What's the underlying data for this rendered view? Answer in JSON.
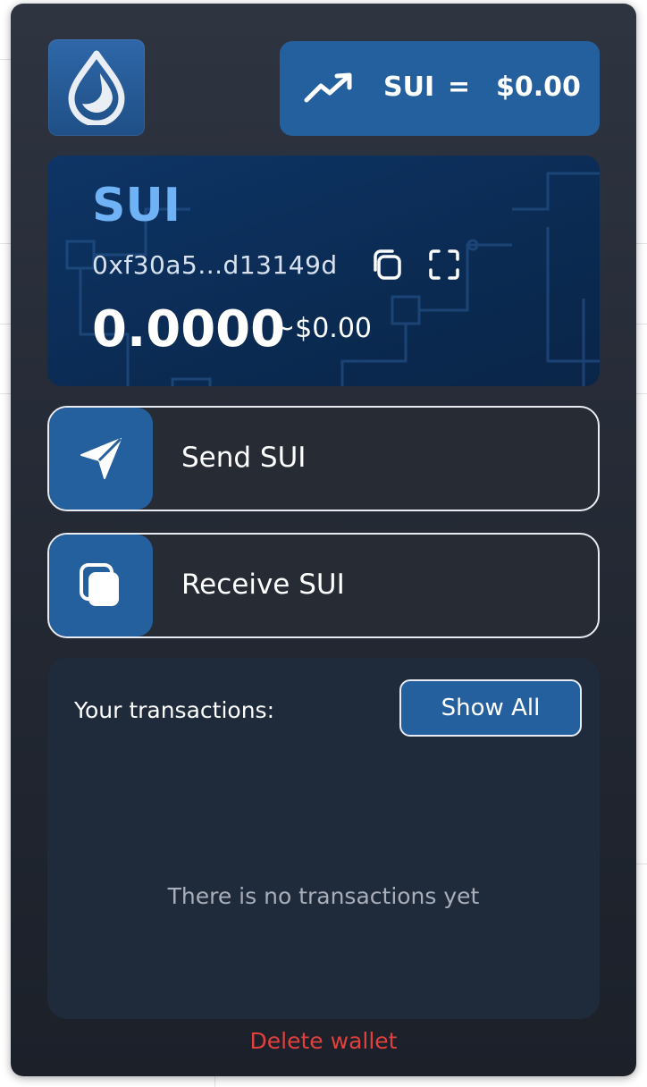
{
  "wallet": {
    "token_symbol": "SUI",
    "price_chip": {
      "symbol": "SUI",
      "equals": "=",
      "price": "$0.00"
    },
    "card": {
      "title": "SUI",
      "address": "0xf30a5...d13149d",
      "balance": "0.0000",
      "balance_usd": "~$0.00"
    },
    "actions": {
      "send_label": "Send SUI",
      "receive_label": "Receive SUI"
    },
    "transactions": {
      "heading": "Your transactions:",
      "show_all_label": "Show All",
      "empty_text": "There is no transactions yet"
    },
    "delete_label": "Delete wallet"
  },
  "colors": {
    "accent": "#245f9e",
    "title_blue": "#6fb2f5",
    "danger": "#e0413d",
    "panel": "#1f2a3b"
  },
  "icons": {
    "logo": "sui-drop-icon",
    "trend": "trending-up-icon",
    "copy": "copy-icon",
    "expand": "expand-icon",
    "send": "send-arrow-icon",
    "receive": "receive-cards-icon"
  }
}
